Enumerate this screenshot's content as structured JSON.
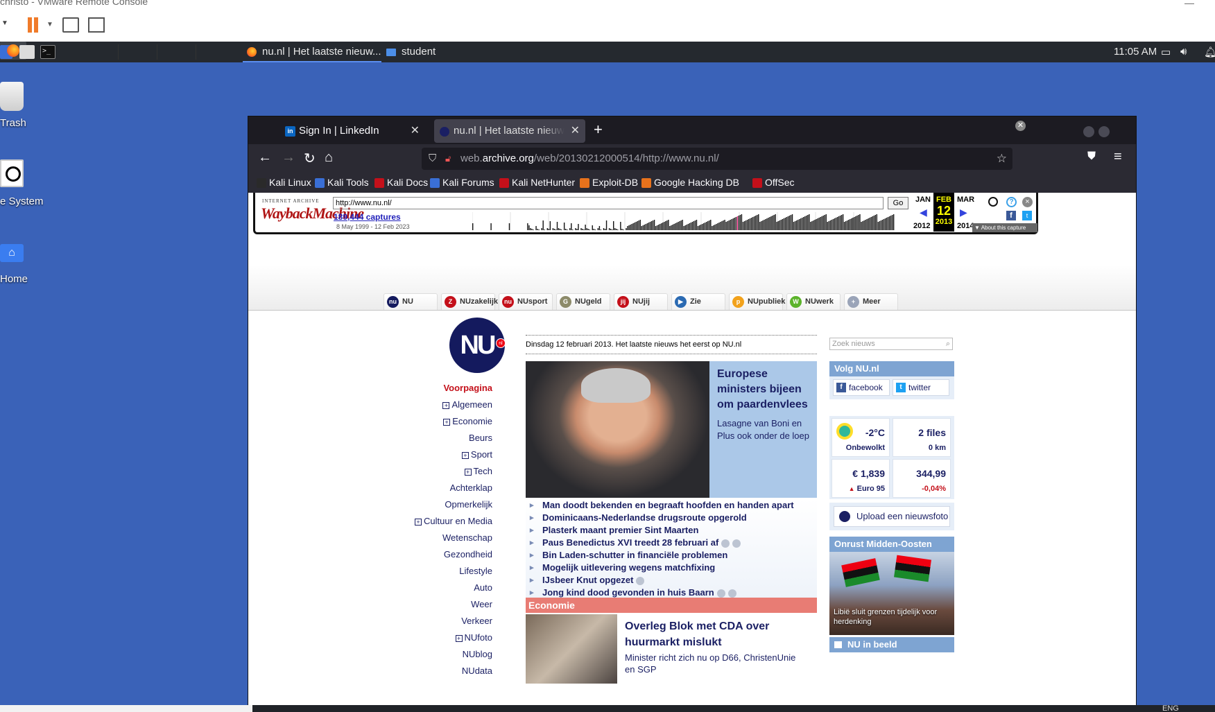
{
  "vmware": {
    "title": "christo - VMware Remote Console",
    "window_control": "—"
  },
  "taskbar": {
    "term_glyph": ">_",
    "tasks": [
      {
        "label": "nu.nl | Het laatste nieuw..."
      },
      {
        "label": "student"
      }
    ],
    "clock": "11:05 AM"
  },
  "desktop": {
    "icons": [
      {
        "label": "Trash"
      },
      {
        "label": "e System"
      },
      {
        "label": "Home"
      }
    ]
  },
  "browser": {
    "tabs": [
      {
        "label": "Sign In | LinkedIn",
        "favicon": "in"
      },
      {
        "label": "nu.nl | Het laatste nieuws"
      }
    ],
    "url_prefix": "web.",
    "url_domain": "archive.org",
    "url_path": "/web/20130212000514/http://www.nu.nl/",
    "bookmarks": [
      {
        "label": "Kali Linux",
        "color": "#2a2a2a"
      },
      {
        "label": "Kali Tools",
        "color": "#3a6fd6"
      },
      {
        "label": "Kali Docs",
        "color": "#c4101a"
      },
      {
        "label": "Kali Forums",
        "color": "#3a6fd6"
      },
      {
        "label": "Kali NetHunter",
        "color": "#c4101a"
      },
      {
        "label": "Exploit-DB",
        "color": "#e8721c"
      },
      {
        "label": "Google Hacking DB",
        "color": "#e8721c"
      },
      {
        "label": "OffSec",
        "color": "#c4101a"
      }
    ]
  },
  "wayback": {
    "logo_top": "INTERNET ARCHIVE",
    "logo": "WaybackMachine",
    "url": "http://www.nu.nl/",
    "go": "Go",
    "captures": "189,444 captures",
    "range": "8 May 1999 - 12 Feb 2023",
    "prev_month": "JAN",
    "cur_month": "FEB",
    "cur_day": "12",
    "next_month": "MAR",
    "prev_year": "2012",
    "cur_year": "2013",
    "next_year": "2014",
    "help": "?",
    "close": "×",
    "fb": "f",
    "tw": "t",
    "about": "▼ About this capture"
  },
  "nu": {
    "tabs": [
      {
        "label": "NU",
        "icon": "nu",
        "color": "#141a5e"
      },
      {
        "label": "NUzakelijk",
        "icon": "Z",
        "color": "#c4101a"
      },
      {
        "label": "NUsport",
        "icon": "nu",
        "color": "#c4101a"
      },
      {
        "label": "NUgeld",
        "icon": "G",
        "color": "#8d8b6a"
      },
      {
        "label": "NUjij",
        "icon": "jij",
        "color": "#c4101a"
      },
      {
        "label": "Zie",
        "icon": "▶",
        "color": "#2b6ab2"
      },
      {
        "label": "NUpubliek",
        "icon": "p",
        "color": "#f2a21c"
      },
      {
        "label": "NUwerk",
        "icon": "W",
        "color": "#5bb32a"
      },
      {
        "label": "Meer",
        "icon": "+",
        "color": "#9aa4b8"
      }
    ],
    "logo": "NU",
    "logo_badge": "nl",
    "nav": [
      {
        "label": "Voorpagina",
        "expand": false,
        "active": true
      },
      {
        "label": "Algemeen",
        "expand": true
      },
      {
        "label": "Economie",
        "expand": true
      },
      {
        "label": "Beurs",
        "expand": false
      },
      {
        "label": "Sport",
        "expand": true
      },
      {
        "label": "Tech",
        "expand": true
      },
      {
        "label": "Achterklap",
        "expand": false
      },
      {
        "label": "Opmerkelijk",
        "expand": false
      },
      {
        "label": "Cultuur en Media",
        "expand": true
      },
      {
        "label": "Wetenschap",
        "expand": false
      },
      {
        "label": "Gezondheid",
        "expand": false
      },
      {
        "label": "Lifestyle",
        "expand": false
      },
      {
        "label": "Auto",
        "expand": false
      },
      {
        "label": "Weer",
        "expand": false
      },
      {
        "label": "Verkeer",
        "expand": false
      },
      {
        "label": "NUfoto",
        "expand": true
      },
      {
        "label": "NUblog",
        "expand": false
      },
      {
        "label": "NUdata",
        "expand": false
      }
    ],
    "dateline": "Dinsdag 12 februari 2013. Het laatste nieuws het eerst op NU.nl",
    "search_placeholder": "Zoek nieuws",
    "lead": {
      "title": "Europese ministers bijeen om paardenvlees",
      "sub": "Lasagne van Boni en Plus ook onder de loep"
    },
    "headlines": [
      {
        "text": "Man doodt bekenden en begraaft hoofden en handen apart",
        "media": 0
      },
      {
        "text": "Dominicaans-Nederlandse drugsroute opgerold",
        "media": 0
      },
      {
        "text": "Plasterk maant premier Sint Maarten",
        "media": 0
      },
      {
        "text": "Paus Benedictus XVI treedt 28 februari af",
        "media": 2
      },
      {
        "text": "Bin Laden-schutter in financiële problemen",
        "media": 0
      },
      {
        "text": "Mogelijk uitlevering wegens matchfixing",
        "media": 0
      },
      {
        "text": "IJsbeer Knut opgezet",
        "media": 1
      },
      {
        "text": "Jong kind dood gevonden in huis Baarn",
        "media": 2
      }
    ],
    "econ": {
      "section": "Economie",
      "title": "Overleg Blok met CDA over huurmarkt mislukt",
      "sub": "Minister richt zich nu op D66, ChristenUnie en SGP"
    },
    "follow": {
      "title": "Volg NU.nl",
      "facebook": "facebook",
      "twitter": "twitter",
      "fb_glyph": "f",
      "tw_glyph": "t"
    },
    "info": {
      "temp": "-2°C",
      "weather": "Onbewolkt",
      "files": "2 files",
      "files_km": "0 km",
      "fuel_price": "€ 1,839",
      "fuel_label": "Euro 95",
      "fuel_arrow": "▲",
      "aex": "344,99",
      "aex_change": "-0,04%"
    },
    "upload": "Upload een nieuwsfoto",
    "mideast": {
      "title": "Onrust Midden-Oosten",
      "caption": "Libië sluit grenzen tijdelijk voor herdenking"
    },
    "inbeeld": {
      "title": "NU in beeld"
    }
  },
  "bottom": {
    "lang": "ENG"
  }
}
